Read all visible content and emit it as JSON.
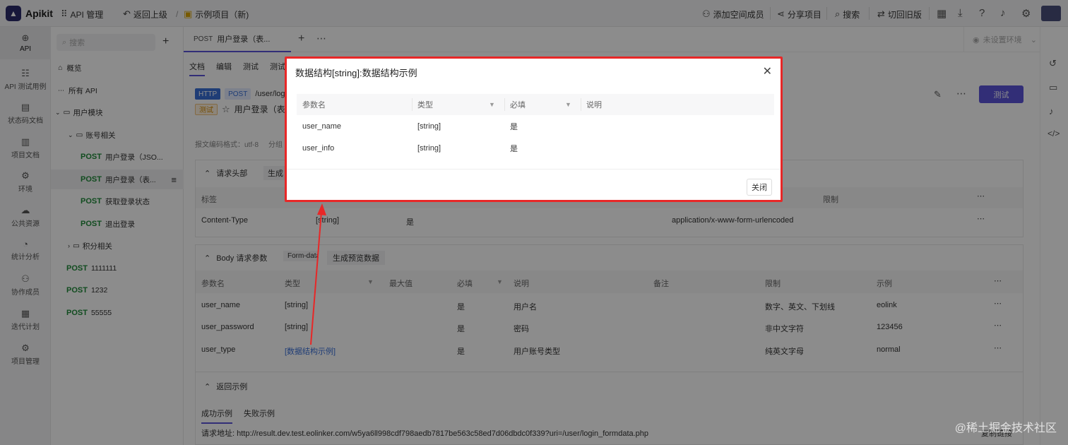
{
  "app": {
    "logo_text": "Apikit"
  },
  "topbar": {
    "api_manage": "API 管理",
    "back": "返回上级",
    "slash": "/",
    "project": "示例项目（新)",
    "add_member": "添加空间成员",
    "share": "分享项目",
    "search": "搜索",
    "old_version": "切回旧版"
  },
  "leftnav": {
    "items": [
      {
        "label": "API",
        "icon": "api-icon"
      },
      {
        "label": "API 测试用例",
        "icon": "test-case-icon"
      },
      {
        "label": "状态码文档",
        "icon": "status-code-icon"
      },
      {
        "label": "项目文档",
        "icon": "doc-icon"
      },
      {
        "label": "环境",
        "icon": "environment-icon"
      },
      {
        "label": "公共资源",
        "icon": "public-resource-icon"
      },
      {
        "label": "统计分析",
        "icon": "statistics-icon"
      },
      {
        "label": "协作成员",
        "icon": "members-icon"
      },
      {
        "label": "迭代计划",
        "icon": "iteration-icon"
      },
      {
        "label": "项目管理",
        "icon": "project-manage-icon"
      }
    ]
  },
  "tree": {
    "search_placeholder": "搜索",
    "add": "+",
    "overview": "概览",
    "all_api": "所有 API",
    "user_module": "用户模块",
    "account": "账号相关",
    "method": "POST",
    "apis": [
      {
        "name": "用户登录（JSO..."
      },
      {
        "name": "用户登录（表..."
      },
      {
        "name": "获取登录状态"
      },
      {
        "name": "退出登录"
      }
    ],
    "points": "积分相关",
    "root_apis": [
      {
        "name": "1111111"
      },
      {
        "name": "1232"
      },
      {
        "name": "55555"
      }
    ]
  },
  "main": {
    "tab_method": "POST",
    "tab_name": "用户登录（表...",
    "env": "未设置环境",
    "subtabs": [
      "文档",
      "编辑",
      "测试",
      "测试"
    ],
    "http": "HTTP",
    "method": "POST",
    "url": "/user/log",
    "status": "测试",
    "api_name": "用户登录（表",
    "test_btn": "测试",
    "encoding": "报文编码格式：utf-8",
    "group": "分组",
    "req_header": {
      "title": "请求头部",
      "gen": "生成",
      "cols": [
        "标签",
        "限制"
      ],
      "row": {
        "label": "Content-Type",
        "type": "[string]",
        "required": "是",
        "example": "application/x-www-form-urlencoded"
      }
    },
    "body": {
      "title": "Body 请求参数",
      "form": "Form-data",
      "gen": "生成预览数据",
      "cols": [
        "参数名",
        "类型",
        "最大值",
        "必填",
        "说明",
        "备注",
        "限制",
        "示例"
      ],
      "rows": [
        {
          "name": "user_name",
          "type": "[string]",
          "required": "是",
          "desc": "用户名",
          "limit": "数字、英文、下划线",
          "example": "eolink"
        },
        {
          "name": "user_password",
          "type": "[string]",
          "required": "是",
          "desc": "密码",
          "limit": "非中文字符",
          "example": "123456"
        },
        {
          "name": "user_type",
          "type": "[数据结构示例]",
          "required": "是",
          "desc": "用户账号类型",
          "limit": "纯英文字母",
          "example": "normal"
        }
      ]
    },
    "response": {
      "title": "返回示例",
      "tab_success": "成功示例",
      "tab_fail": "失败示例",
      "url_label": "请求地址:",
      "url": "http://result.dev.test.eolinker.com/w5ya6ll998cdf798aedb7817be563c58ed7d06dbdc0f339?uri=/user/login_formdata.php",
      "copy": "复制链接"
    }
  },
  "dialog": {
    "title": "数据结构[string]:数据结构示例",
    "close_icon": "close-icon",
    "cols": [
      "参数名",
      "类型",
      "必填",
      "说明"
    ],
    "rows": [
      {
        "name": "user_name",
        "type": "[string]",
        "required": "是"
      },
      {
        "name": "user_info",
        "type": "[string]",
        "required": "是"
      }
    ],
    "close_btn": "关闭"
  },
  "watermark": "@稀土掘金技术社区",
  "colors": {
    "accent": "#5b54d9",
    "post": "#1f8a3a",
    "highlight": "#e82727",
    "link": "#3a6fd8"
  }
}
